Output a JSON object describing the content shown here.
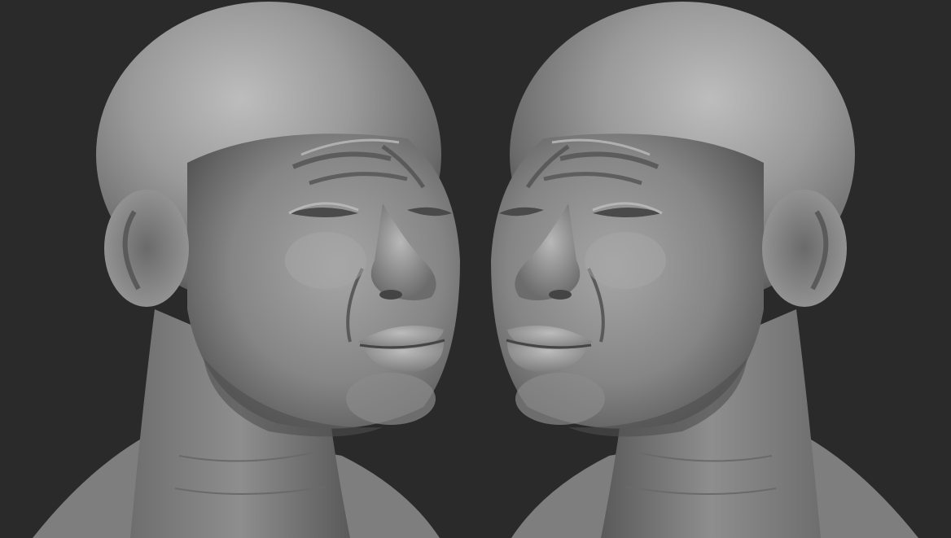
{
  "scene": {
    "background_color": "#2a2a2a",
    "sculpt_color": "#8f8f8f",
    "highlight_color": "#c4c4c4",
    "shadow_color": "#3e3e3e",
    "views": [
      {
        "name": "left-head-view",
        "facing": "right"
      },
      {
        "name": "right-head-view",
        "facing": "left",
        "mirrored": true
      }
    ]
  }
}
